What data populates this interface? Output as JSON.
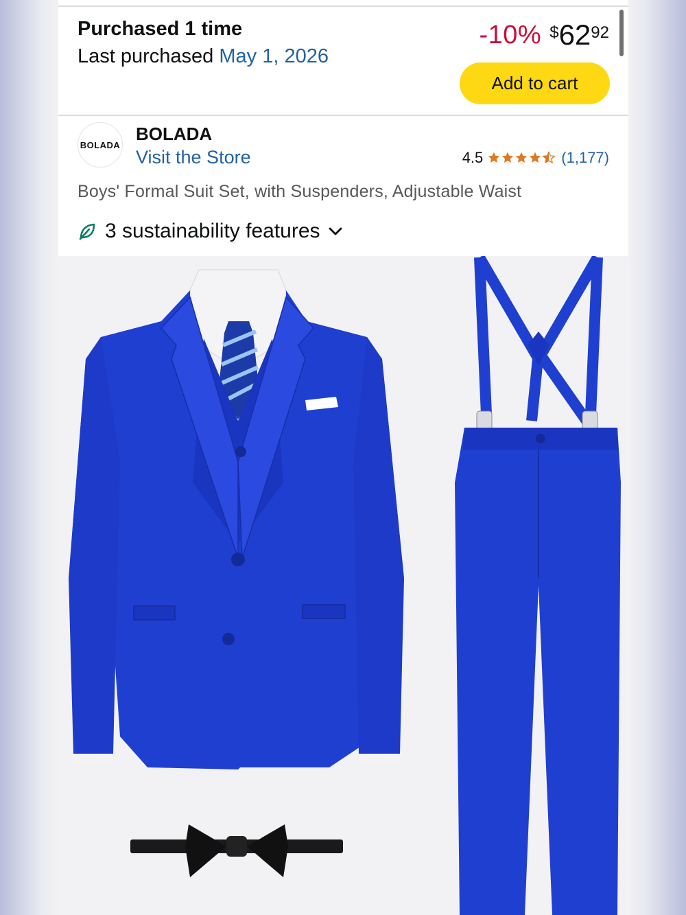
{
  "purchase": {
    "title": "Purchased 1 time",
    "last_label": "Last purchased",
    "last_date": "May 1, 2026"
  },
  "price": {
    "discount": "-10%",
    "currency": "$",
    "whole": "62",
    "fraction": "92"
  },
  "cart": {
    "label": "Add to cart"
  },
  "seller": {
    "logo_text": "BOLADA",
    "brand": "BOLADA",
    "store_link": "Visit the Store"
  },
  "rating": {
    "value": "4.5",
    "count": "(1,177)",
    "stars_fill": [
      1,
      1,
      1,
      1,
      0.5
    ]
  },
  "product": {
    "title": "Boys' Formal Suit Set, with Suspenders, Adjustable Waist"
  },
  "sustainability": {
    "label": "3 sustainability features"
  },
  "colors": {
    "link": "#2162a1",
    "discount": "#cc0c39",
    "cart_button": "#ffd814",
    "star": "#de7921",
    "suit": "#1f3fd0"
  }
}
